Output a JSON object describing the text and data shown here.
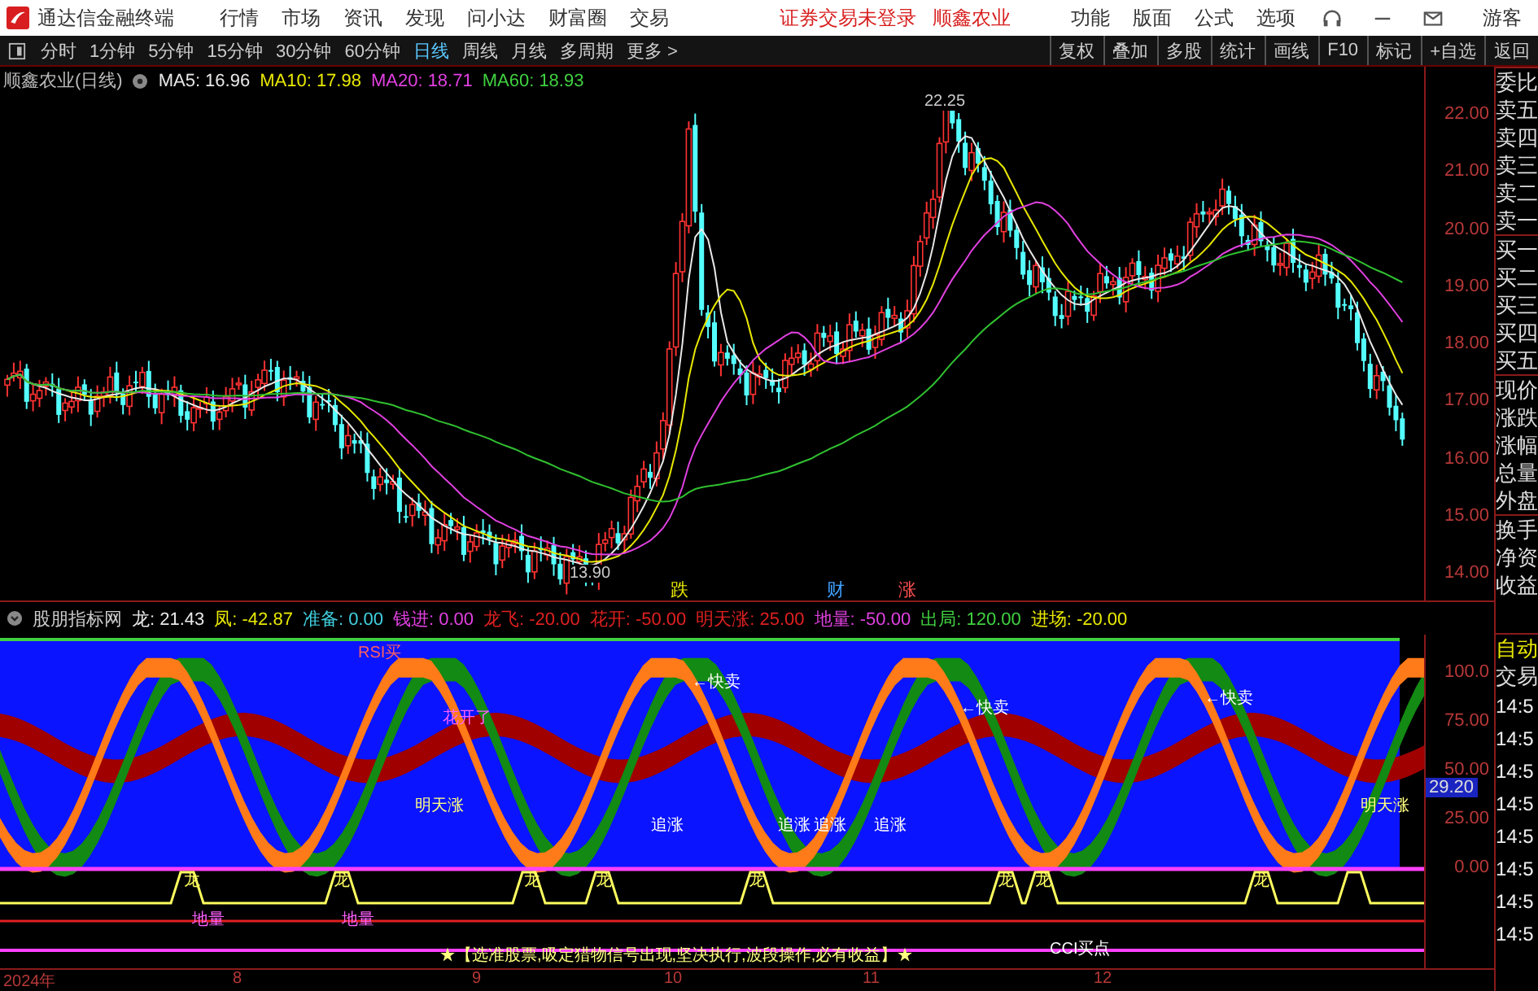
{
  "title_bar": {
    "app_name": "通达信金融终端",
    "menu": [
      "行情",
      "市场",
      "资讯",
      "发现",
      "问小达",
      "财富圈",
      "交易"
    ],
    "login_status": "证券交易未登录",
    "stock_name": "顺鑫农业",
    "right_menu": [
      "功能",
      "版面",
      "公式",
      "选项"
    ],
    "user": "游客"
  },
  "period_tabs": [
    {
      "label": "分时",
      "selected": false
    },
    {
      "label": "1分钟",
      "selected": false
    },
    {
      "label": "5分钟",
      "selected": false
    },
    {
      "label": "15分钟",
      "selected": false
    },
    {
      "label": "30分钟",
      "selected": false
    },
    {
      "label": "60分钟",
      "selected": false
    },
    {
      "label": "日线",
      "selected": true
    },
    {
      "label": "周线",
      "selected": false
    },
    {
      "label": "月线",
      "selected": false
    },
    {
      "label": "多周期",
      "selected": false
    },
    {
      "label": "更多 >",
      "selected": false
    }
  ],
  "tools": [
    "复权",
    "叠加",
    "多股",
    "统计",
    "画线",
    "F10",
    "标记",
    "+自选",
    "返回"
  ],
  "main_chart": {
    "title": "顺鑫农业(日线)",
    "moving_averages": [
      {
        "label": "MA5:",
        "value": "16.96",
        "color": "#e8e8e8"
      },
      {
        "label": "MA10:",
        "value": "17.98",
        "color": "#e8e800"
      },
      {
        "label": "MA20:",
        "value": "18.71",
        "color": "#e040e0"
      },
      {
        "label": "MA60:",
        "value": "18.93",
        "color": "#40d040"
      }
    ],
    "y_labels": [
      "22.00",
      "21.00",
      "20.00",
      "19.00",
      "18.00",
      "17.00",
      "16.00",
      "15.00",
      "14.00"
    ],
    "high_label": "22.25",
    "low_label": "13.90",
    "markers": [
      {
        "text": "跌",
        "color": "#e8e800"
      },
      {
        "text": "财",
        "color": "#40a0ff"
      },
      {
        "text": "涨",
        "color": "#ff5050"
      }
    ]
  },
  "indicator": {
    "name": "股朋指标网",
    "readings": [
      {
        "label": "龙:",
        "value": "21.43",
        "color": "#e8e8e8"
      },
      {
        "label": "凤:",
        "value": "-42.87",
        "color": "#e8e800"
      },
      {
        "label": "准备:",
        "value": "0.00",
        "color": "#40d0e0"
      },
      {
        "label": "钱进:",
        "value": "0.00",
        "color": "#e040e0"
      },
      {
        "label": "龙飞:",
        "value": "-20.00",
        "color": "#e02020"
      },
      {
        "label": "花开:",
        "value": "-50.00",
        "color": "#e02020"
      },
      {
        "label": "明天涨:",
        "value": "25.00",
        "color": "#e02020"
      },
      {
        "label": "地量:",
        "value": "-50.00",
        "color": "#e040e0"
      },
      {
        "label": "出局:",
        "value": "120.00",
        "color": "#40d040"
      },
      {
        "label": "进场:",
        "value": "-20.00",
        "color": "#e8e800"
      }
    ],
    "y_labels": [
      "100.0",
      "75.00",
      "50.00",
      "25.00",
      "0.00"
    ],
    "current_value": "29.20",
    "signals": [
      {
        "text": "RSI买"
      },
      {
        "text": "花开了"
      },
      {
        "text": "←快卖"
      },
      {
        "text": "←快卖"
      },
      {
        "text": "←快卖"
      },
      {
        "text": "追涨"
      },
      {
        "text": "追涨"
      },
      {
        "text": "追涨"
      },
      {
        "text": "追涨"
      },
      {
        "text": "明天涨"
      },
      {
        "text": "明天涨"
      },
      {
        "text": "龙"
      },
      {
        "text": "龙"
      },
      {
        "text": "龙"
      },
      {
        "text": "龙"
      },
      {
        "text": "龙"
      },
      {
        "text": "龙"
      },
      {
        "text": "龙"
      },
      {
        "text": "龙"
      },
      {
        "text": "地量"
      },
      {
        "text": "地量"
      },
      {
        "text": "CCI买点"
      }
    ],
    "banner": "★【选准股票,吸定猎物信号出现,坚决执行,波段操作,必有收益】★"
  },
  "x_labels": [
    "2024年",
    "8",
    "9",
    "10",
    "11",
    "12"
  ],
  "quote_panel": [
    "委比",
    "卖五",
    "卖四",
    "卖三",
    "卖二",
    "卖一",
    "买一",
    "买二",
    "买三",
    "买四",
    "买五",
    "现价",
    "涨跌",
    "涨幅",
    "总量",
    "外盘",
    "换手",
    "净资",
    "收益"
  ],
  "trade_panel": {
    "title": [
      "自动",
      "交易"
    ],
    "times": [
      "14:5",
      "14:5",
      "14:5",
      "14:5",
      "14:5",
      "14:5",
      "14:5",
      "14:5"
    ]
  }
}
